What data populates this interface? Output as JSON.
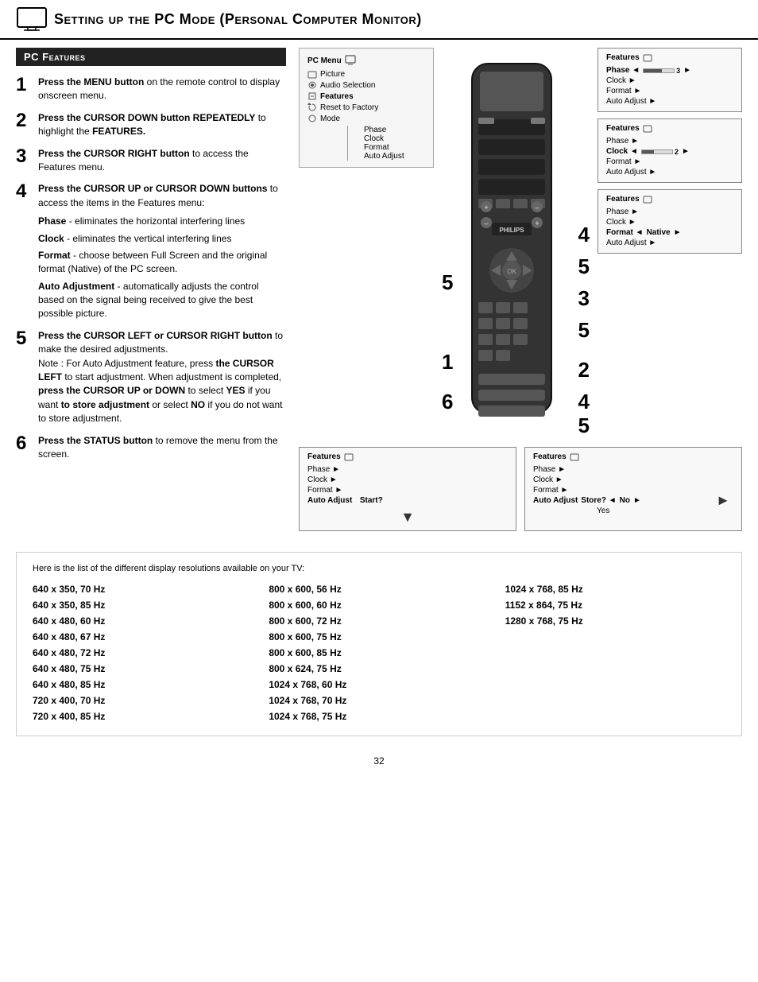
{
  "header": {
    "title": "Setting up the PC Mode (Personal Computer Monitor)"
  },
  "pc_features": {
    "section_title": "PC Features",
    "steps": [
      {
        "number": "1",
        "html": "<b>Press the MENU button</b> on the remote control to display onscreen menu."
      },
      {
        "number": "2",
        "html": "<b>Press the CURSOR DOWN button REPEATEDLY</b> to highlight the <b>FEATURES.</b>"
      },
      {
        "number": "3",
        "html": "<b>Press the CURSOR RIGHT button</b> to access the Features menu."
      },
      {
        "number": "4",
        "html": "<b>Press the CURSOR UP or CURSOR DOWN buttons</b> to access the items in the Features menu:"
      },
      {
        "number": "5",
        "html": "<b>Press the CURSOR LEFT or CURSOR RIGHT button</b> to make the desired adjustments.<br>Note : For Auto Adjustment feature, press <b>the CURSOR LEFT</b> to start adjustment. When adjustment is completed, <b>press the CURSOR UP or DOWN</b> to select <b>YES</b> if you want <b>to store adjustment</b> or select <b>NO</b> if you do not want to store adjustment."
      },
      {
        "number": "6",
        "html": "<b>Press the STATUS button</b> to remove the menu from the screen."
      }
    ],
    "sub_items": [
      {
        "title": "Phase",
        "desc": "- eliminates the horizontal interfering lines"
      },
      {
        "title": "Clock",
        "desc": "- eliminates the vertical interfering lines"
      },
      {
        "title": "Format",
        "desc": "- choose between Full Screen and the original format (Native) of the PC screen."
      },
      {
        "title": "Auto Adjustment",
        "desc": "- automatically adjusts the control based on the signal being received to give the best possible picture."
      }
    ]
  },
  "menu_diagram": {
    "title": "PC Menu",
    "items": [
      {
        "label": "Picture",
        "icon": true
      },
      {
        "label": "Audio Selection",
        "icon": true
      },
      {
        "label": "Features",
        "icon": true,
        "bold": true
      },
      {
        "label": "Reset to Factory",
        "icon": true
      },
      {
        "label": "Mode",
        "icon": true
      }
    ],
    "sub_items": [
      "Phase",
      "Clock",
      "Format",
      "Auto Adjust"
    ]
  },
  "feature_boxes": [
    {
      "id": "box1",
      "title": "Features",
      "rows": [
        {
          "label": "Phase",
          "arrow": "right",
          "slider": true,
          "value": "3",
          "has_right_arrow": true
        },
        {
          "label": "Clock",
          "arrow": "right",
          "bold": false
        },
        {
          "label": "Format",
          "arrow": "right",
          "bold": false
        },
        {
          "label": "Auto Adjust",
          "arrow": "right",
          "bold": false
        }
      ]
    },
    {
      "id": "box2",
      "title": "Features",
      "rows": [
        {
          "label": "Phase",
          "arrow": "right",
          "bold": false
        },
        {
          "label": "Clock",
          "arrow": "right",
          "slider": true,
          "value": "2",
          "bold": true
        },
        {
          "label": "Format",
          "arrow": "right",
          "bold": false
        },
        {
          "label": "Auto Adjust",
          "arrow": "right",
          "bold": false
        }
      ]
    },
    {
      "id": "box3",
      "title": "Features",
      "rows": [
        {
          "label": "Phase",
          "arrow": "right",
          "bold": false
        },
        {
          "label": "Clock",
          "arrow": "right",
          "bold": false
        },
        {
          "label": "Format",
          "arrow": "right",
          "value": "Native",
          "bold": true
        },
        {
          "label": "Auto Adjust",
          "arrow": "right",
          "bold": false
        }
      ]
    }
  ],
  "auto_boxes": [
    {
      "id": "auto1",
      "title": "Features",
      "rows": [
        {
          "label": "Phase",
          "arrow": "right"
        },
        {
          "label": "Clock",
          "arrow": "right"
        },
        {
          "label": "Format",
          "arrow": "right"
        },
        {
          "label": "Auto Adjust",
          "question": "Start?",
          "bold": true
        }
      ]
    },
    {
      "id": "auto2",
      "title": "Features",
      "rows": [
        {
          "label": "Phase",
          "arrow": "right"
        },
        {
          "label": "Clock",
          "arrow": "right"
        },
        {
          "label": "Format",
          "arrow": "right"
        },
        {
          "label": "Auto Adjust",
          "question": "Store?",
          "options": [
            "No",
            "Yes"
          ],
          "bold": true
        }
      ]
    }
  ],
  "resolution_section": {
    "intro": "Here is the list of the different display resolutions available on your TV:",
    "col1": [
      "640 x 350, 70 Hz",
      "640 x 350, 85 Hz",
      "640 x 480, 60 Hz",
      "640 x 480, 67 Hz",
      "640 x 480, 72 Hz",
      "640 x 480, 75 Hz",
      "640 x 480, 85 Hz",
      "720 x 400, 70 Hz",
      "720 x 400, 85 Hz"
    ],
    "col2": [
      "800 x 600, 56 Hz",
      "800 x 600, 60 Hz",
      "800 x 600, 72 Hz",
      "800 x 600, 75 Hz",
      "800 x 600, 85 Hz",
      "800 x 624, 75 Hz",
      "1024 x 768, 60 Hz",
      "1024 x 768, 70 Hz",
      "1024 x 768, 75 Hz"
    ],
    "col3": [
      "1024 x 768, 85 Hz",
      "1152 x 864, 75 Hz",
      "1280 x 768, 75 Hz"
    ]
  },
  "page_number": "32"
}
